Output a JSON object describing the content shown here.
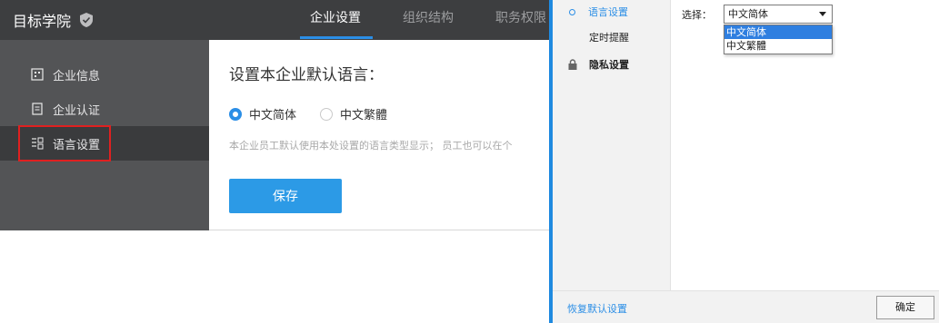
{
  "app": {
    "brand": "目标学院",
    "nav_tabs": [
      "企业设置",
      "组织结构",
      "职务权限"
    ]
  },
  "sidebar": {
    "items": [
      {
        "label": "企业信息",
        "icon": "building-icon"
      },
      {
        "label": "企业认证",
        "icon": "certificate-icon"
      },
      {
        "label": "语言设置",
        "icon": "language-icon"
      }
    ],
    "active_index": 2
  },
  "content": {
    "title": "设置本企业默认语言：",
    "options": [
      "中文简体",
      "中文繁體"
    ],
    "selected_option": "中文简体",
    "hint": "本企业员工默认使用本处设置的语言类型显示； 员工也可以在个",
    "save_label": "保存"
  },
  "dialog": {
    "menu": [
      "语言设置",
      "定时提醒",
      "隐私设置"
    ],
    "active_menu": "语言设置",
    "select_label": "选择：",
    "select_value": "中文简体",
    "dropdown_options": [
      "中文简体",
      "中文繁體"
    ],
    "hovered_option": "中文简体",
    "reset_label": "恢复默认设置",
    "ok_label": "确定"
  },
  "colors": {
    "accent": "#2b8ee6",
    "topbar": "#3d3e40",
    "sidebar": "#535456",
    "highlight": "#e02020"
  }
}
